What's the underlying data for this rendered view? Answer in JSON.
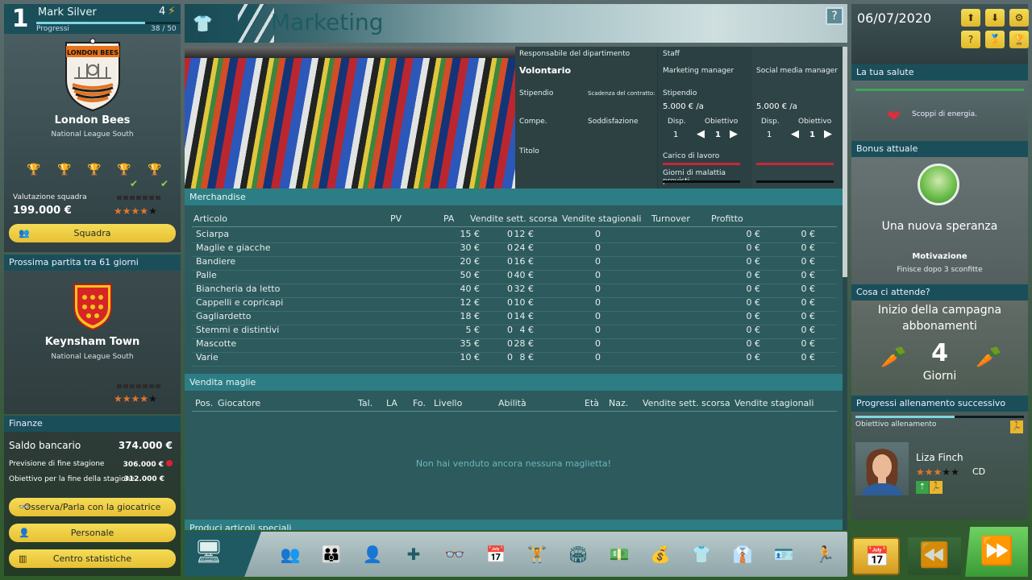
{
  "player": {
    "rank": "1",
    "name": "Mark Silver",
    "level": "4",
    "progress_label": "Progressi",
    "progress_count": "38 / 50",
    "progress_fraction": 0.76
  },
  "club": {
    "name": "London Bees",
    "league": "National League South",
    "crest_text": "LONDON BEES",
    "valuation_label": "Valutazione squadra",
    "valuation": "199.000 €",
    "stars": 4,
    "squad_button": "Squadra"
  },
  "next_match": {
    "header": "Prossima partita tra 61 giorni",
    "opponent": "Keynsham Town",
    "league": "National League South",
    "stars": 4
  },
  "finance": {
    "header": "Finanze",
    "balance_label": "Saldo bancario",
    "balance": "374.000 €",
    "forecast_label": "Previsione di fine stagione",
    "forecast": "306.000 €",
    "target_label": "Obiettivo per la fine della stagione",
    "target": "312.000 €",
    "btn_observe": "Osserva/Parla con la giocatrice",
    "btn_staff": "Personale",
    "btn_stats": "Centro statistiche"
  },
  "header": {
    "title": "Marketing",
    "help": "?"
  },
  "department": {
    "head_label": "Responsabile del dipartimento",
    "head_value": "Volontario",
    "salary_label": "Stipendio",
    "contract_label": "Scadenza del contratto:",
    "skill_label": "Compe.",
    "satisfaction_label": "Soddisfazione",
    "title_label": "Titolo",
    "staff_label": "Staff",
    "staff": [
      {
        "role": "Marketing manager",
        "salary_label": "Stipendio",
        "salary": "5.000 € /a",
        "avail_label": "Disp.",
        "avail": "1",
        "target_label": "Obiettivo",
        "target": "1",
        "workload_label": "Carico di lavoro",
        "sick_label": "Giorni di malattia previsti"
      },
      {
        "role": "Social media manager",
        "salary": "5.000 € /a",
        "avail_label": "Disp.",
        "avail": "1",
        "target_label": "Obiettivo",
        "target": "1"
      }
    ]
  },
  "merch": {
    "title": "Merchandise",
    "columns": [
      "Articolo",
      "PV",
      "PA",
      "Vendite sett. scorsa",
      "Vendite stagionali",
      "Turnover",
      "Profitto"
    ],
    "rows": [
      [
        "Sciarpa",
        "15 €",
        "12 €",
        "0",
        "0",
        "0 €",
        "0 €"
      ],
      [
        "Maglie e giacche",
        "30 €",
        "24 €",
        "0",
        "0",
        "0 €",
        "0 €"
      ],
      [
        "Bandiere",
        "20 €",
        "16 €",
        "0",
        "0",
        "0 €",
        "0 €"
      ],
      [
        "Palle",
        "50 €",
        "40 €",
        "0",
        "0",
        "0 €",
        "0 €"
      ],
      [
        "Biancheria da letto",
        "40 €",
        "32 €",
        "0",
        "0",
        "0 €",
        "0 €"
      ],
      [
        "Cappelli e copricapi",
        "12 €",
        "10 €",
        "0",
        "0",
        "0 €",
        "0 €"
      ],
      [
        "Gagliardetto",
        "18 €",
        "14 €",
        "0",
        "0",
        "0 €",
        "0 €"
      ],
      [
        "Stemmi e distintivi",
        "5 €",
        "4 €",
        "0",
        "0",
        "0 €",
        "0 €"
      ],
      [
        "Mascotte",
        "35 €",
        "28 €",
        "0",
        "0",
        "0 €",
        "0 €"
      ],
      [
        "Varie",
        "10 €",
        "8 €",
        "0",
        "0",
        "0 €",
        "0 €"
      ]
    ]
  },
  "shirts": {
    "title": "Vendita maglie",
    "columns": [
      "Pos.",
      "Giocatore",
      "Tal.",
      "LA",
      "Fo.",
      "Livello",
      "Abilità",
      "Età",
      "Naz.",
      "Vendite sett. scorsa",
      "Vendite stagionali"
    ],
    "empty": "Non hai venduto ancora nessuna maglietta!"
  },
  "special": {
    "title": "Produci articoli speciali"
  },
  "date": "06/07/2020",
  "health": {
    "title": "La tua salute",
    "text": "Scoppi di energia."
  },
  "bonus": {
    "title": "Bonus attuale",
    "name": "Una nuova speranza",
    "sub": "Motivazione",
    "desc": "Finisce dopo 3 sconfitte"
  },
  "upcoming": {
    "title": "Cosa ci attende?",
    "event": "Inizio della campagna abbonamenti",
    "days": "4",
    "unit": "Giorni"
  },
  "training": {
    "title": "Progressi allenamento successivo",
    "goal_label": "Obiettivo allenamento",
    "progress_fraction": 0.59,
    "player_name": "Liza Finch",
    "position": "CD",
    "stars": 3
  },
  "colors": {
    "accent": "#1a4f5a",
    "yellow": "#e7c033",
    "green": "#3a9b36",
    "star": "#e2762b"
  }
}
